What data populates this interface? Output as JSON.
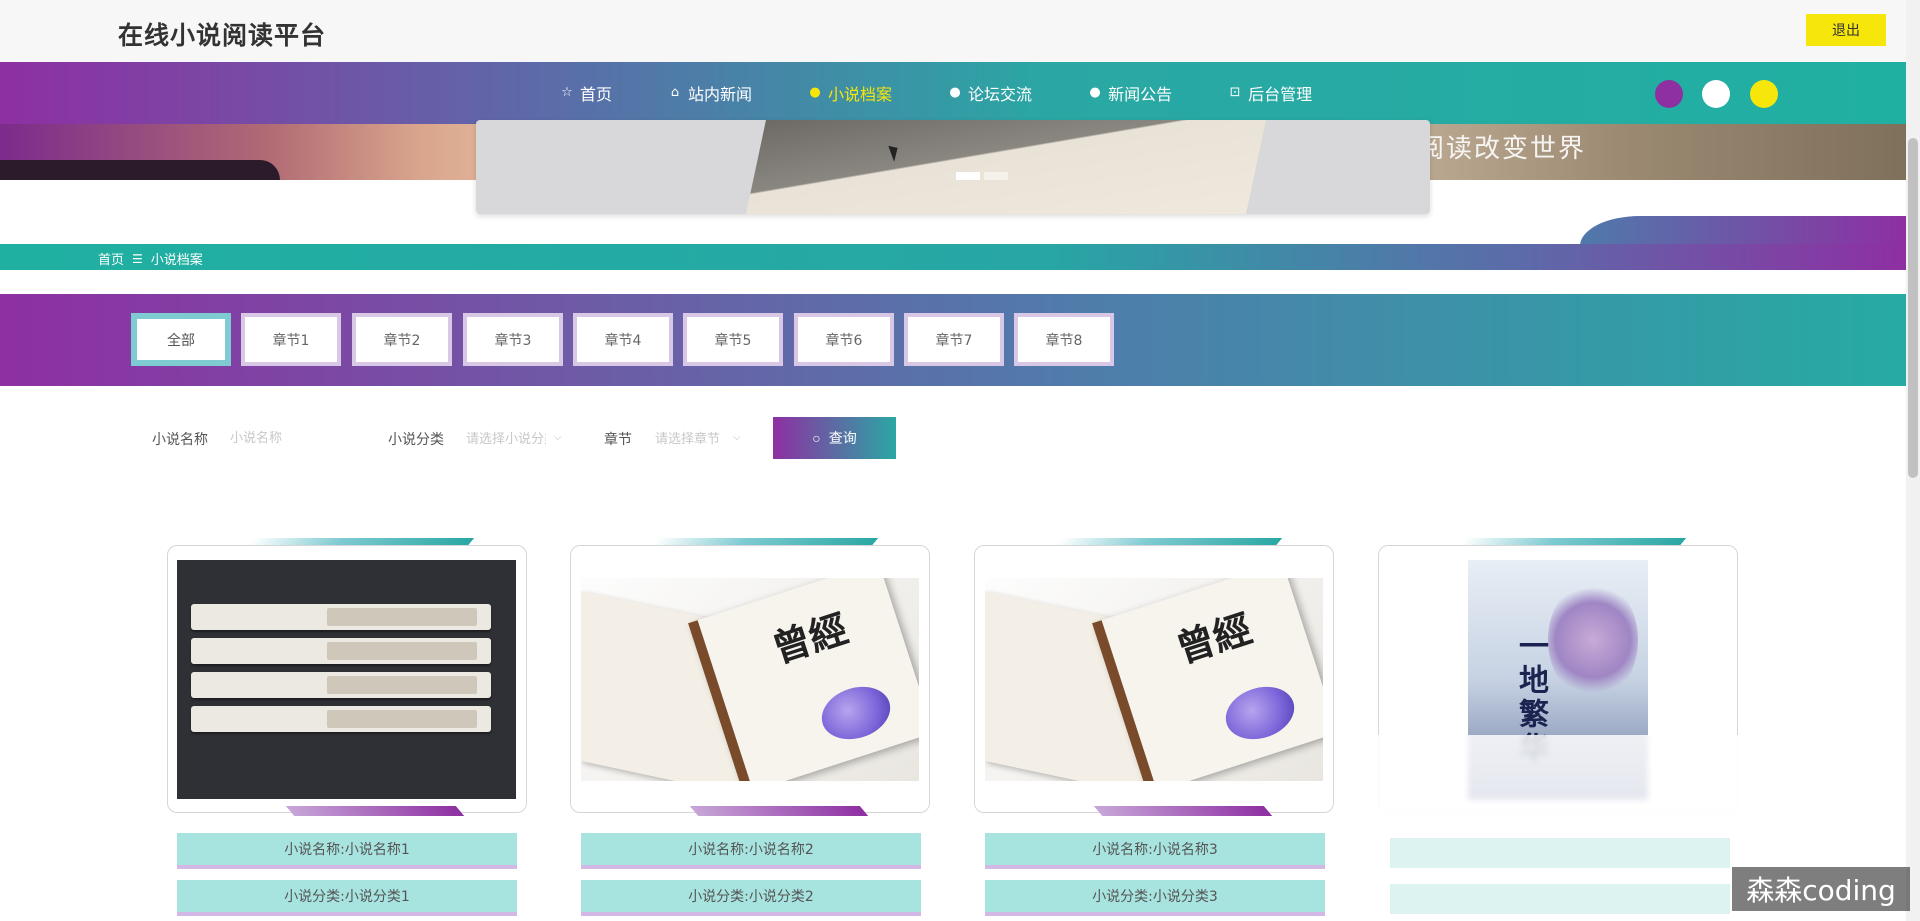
{
  "header": {
    "site_title": "在线小说阅读平台",
    "logout_label": "退出"
  },
  "nav": {
    "items": [
      {
        "label": "首页",
        "icon": "star-icon"
      },
      {
        "label": "站内新闻",
        "icon": "bag-icon"
      },
      {
        "label": "小说档案",
        "icon": "circle-icon",
        "active": true
      },
      {
        "label": "论坛交流",
        "icon": "circle-icon"
      },
      {
        "label": "新闻公告",
        "icon": "info-icon"
      },
      {
        "label": "后台管理",
        "icon": "box-icon"
      }
    ],
    "theme_dots": [
      "#8e2fa2",
      "#ffffff",
      "#f6e60a"
    ]
  },
  "banner": {
    "text": "阅读改变世界"
  },
  "breadcrumb": {
    "home": "首页",
    "separator": "☰",
    "current": "小说档案"
  },
  "categories": [
    "全部",
    "章节1",
    "章节2",
    "章节3",
    "章节4",
    "章节5",
    "章节6",
    "章节7",
    "章节8"
  ],
  "search": {
    "name_label": "小说名称",
    "name_placeholder": "小说名称",
    "type_label": "小说分类",
    "type_placeholder": "请选择小说分类",
    "chapter_label": "章节",
    "chapter_placeholder": "请选择章节",
    "query_label": "查询"
  },
  "cards": [
    {
      "name": "小说名称:小说名称1",
      "type": "小说分类:小说分类1"
    },
    {
      "name": "小说名称:小说名称2",
      "type": "小说分类:小说分类2"
    },
    {
      "name": "小说名称:小说名称3",
      "type": "小说分类:小说分类3"
    }
  ],
  "poster": {
    "title": "一地繁华"
  },
  "watermark": "森森coding",
  "colors": {
    "accent_purple": "#8e2fa2",
    "accent_teal": "#2aa7a4",
    "accent_yellow": "#f6e60a"
  }
}
